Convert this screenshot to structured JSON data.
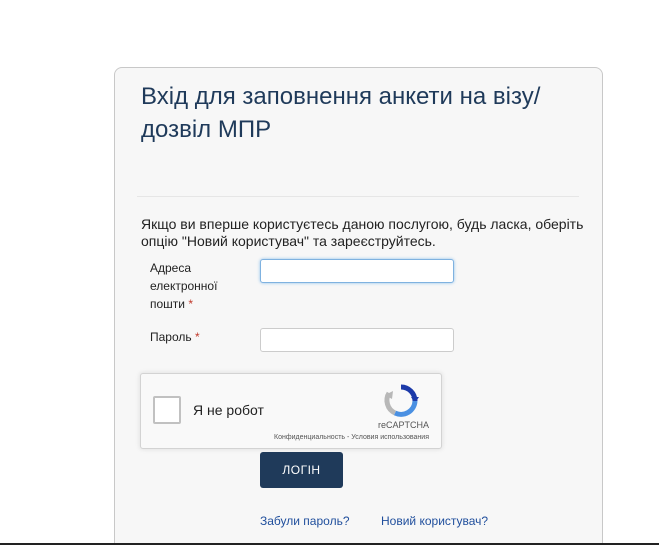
{
  "form": {
    "title": "Вхід для заповнення анкети на візу/ дозвіл МПР",
    "intro": "Якщо ви вперше  користуєтесь даною послугою, будь ласка, оберіть опцію \"Новий користувач\" та зареєструйтесь.",
    "email": {
      "label": "Адреса електронної пошти",
      "required_mark": "*",
      "value": "",
      "placeholder": ""
    },
    "password": {
      "label": "Пароль",
      "required_mark": "*",
      "value": "",
      "placeholder": ""
    },
    "login_label": "ЛОГІН",
    "forgot_link": "Забули пароль?",
    "new_user_link": "Новий користувач?"
  },
  "recaptcha": {
    "checkbox_label": "Я не робот",
    "brand": "reCAPTCHA",
    "privacy": "Конфиденциальность",
    "separator": " - ",
    "terms": "Условия использования",
    "checked": false
  },
  "colors": {
    "accent": "#1f3a5a",
    "link": "#1f4e9c",
    "required": "#c0392b"
  }
}
